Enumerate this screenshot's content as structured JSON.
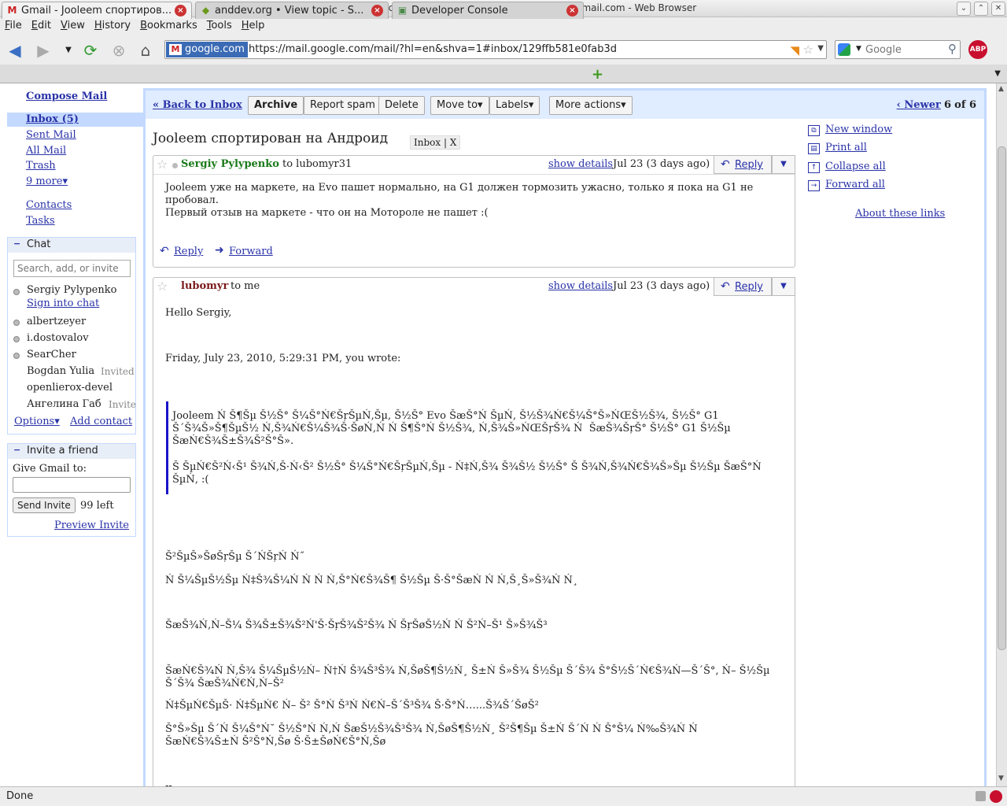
{
  "window": {
    "title": "Gmail - Jooleem спортирован на Андроид - x.pelya.x@gmail.com - Web Browser"
  },
  "menu": [
    "File",
    "Edit",
    "View",
    "History",
    "Bookmarks",
    "Tools",
    "Help"
  ],
  "address": {
    "site": "google.com",
    "url": "https://mail.google.com/mail/?hl=en&shva=1#inbox/129ffb581e0fab3d"
  },
  "search": {
    "placeholder": "Google"
  },
  "abp": "ABP",
  "tabs": [
    {
      "label": "Gmail - Jooleem спортиров..."
    },
    {
      "label": "anddev.org • View topic - S..."
    },
    {
      "label": "Developer Console"
    }
  ],
  "left": {
    "compose": "Compose Mail",
    "inbox": "Inbox (5)",
    "nav": [
      "Sent Mail",
      "All Mail",
      "Trash",
      "9 more▾"
    ],
    "contacts": "Contacts",
    "tasks": "Tasks"
  },
  "chat": {
    "title": "Chat",
    "search_placeholder": "Search, add, or invite",
    "me": "Sergiy Pylypenko",
    "sign_in": "Sign into chat",
    "contacts": [
      "albertzeyer",
      "i.dostovalov",
      "SearCher",
      "Bogdan Yulia",
      "openlierox-devel",
      "Ангелина Габ"
    ],
    "invited": "Invited",
    "invited2": "Invite",
    "options": "Options▾",
    "add_contact": "Add contact"
  },
  "invite": {
    "title": "Invite a friend",
    "give": "Give Gmail to:",
    "send": "Send Invite",
    "left": "99 left",
    "preview": "Preview Invite"
  },
  "toolbar": {
    "back": "« Back to Inbox",
    "archive": "Archive",
    "spam": "Report spam",
    "delete": "Delete",
    "move": "Move to▾",
    "labels": "Labels▾",
    "more": "More actions▾",
    "newer": "‹ Newer",
    "count": "6",
    "of": "of 6"
  },
  "subject": "Jooleem спортирован на Андроид",
  "label_chip": "Inbox",
  "label_x": "X",
  "messages": [
    {
      "from": "Sergiy Pylypenko",
      "to": "to lubomyr31",
      "show_details": "show details",
      "date": "Jul 23 (3 days ago)",
      "reply": "Reply",
      "body": "Jooleem уже на маркете, на Evo пашет нормально, на G1 должен тормозить ужасно, только я пока на G1 не\nпробовал.\nПервый отзыв на маркете - что он на Мотороле не пашет :(",
      "foot_reply": "Reply",
      "foot_forward": "Forward"
    },
    {
      "from": "lubomyr",
      "to": "to me",
      "show_details": "show details",
      "date": "Jul 23 (3 days ago)",
      "reply": "Reply",
      "greeting": "Hello Sergiy,",
      "wrote": "Friday, July 23, 2010, 5:29:31 PM, you wrote:",
      "quote1": "Jooleem Ń Š¶Šµ Š½Š° Š¼Š°Ń€ŠŗŠµŃ‚Šµ, Š½Š° Evo ŠæŠ°Ń ŠµŃ‚ Š½Š¾Ń€Š¼Š°Š»ŃŒŠ½Š¾, Š½Š° G1\nŠ´Š¾Š»Š¶ŠµŠ½ Ń‚Š¾Ń€Š¼Š¾Š·ŠøŃ‚Ń Ń Š¶Š°Ń Š½Š¾, Ń‚Š¾Š»ŃŒŠŗŠ¾ Ń  ŠæŠ¾ŠŗŠ° Š½Š° G1 Š½Šµ\nŠæŃ€Š¾Š±Š¾Š²Š°Š».",
      "quote2": "Š ŠµŃ€Š²Ń‹Š¹ Š¾Ń‚Š·Ń‹Š² Š½Š° Š¼Š°Ń€ŠŗŠµŃ‚Šµ - Ń‡Ń‚Š¾ Š¾Š½ Š½Š° Š Š¾Ń‚Š¾Ń€Š¾Š»Šµ Š½Šµ ŠæŠ°Ń\nŠµŃ‚ :(",
      "p1": "Š²ŠµŠ»ŠøŠŗŠµ Š´ŃŠŗŃ Ń˝",
      "p2": "Ń Š¼ŠµŠ½Šµ Ń‡Š¾Š¼Ń Ń Ń Ń‚Š°Ń€Š¾Š¶ Š½Šµ Š·Š°ŠæŃ Ń Ń‚Š¸Š»Š¾Ń Ń¸",
      "p3": "ŠæŠ¾Ń‚Ń–Š¼ Š¾Š±Š¾Š²Ń'Š·ŠŗŠ¾Š²Š¾ Ń ŠŗŠøŠ½Ń Ń Š²Ń–Š¹ Š»Š¾Š³",
      "p4": "ŠæŃ€Š¾Ń Ń‚Š¾ Š¼ŠµŠ½Ń– Ń†Ń Š¾Š³Š¾ Ń‚ŠøŠ¶Š½Ń¸ Š±Ń Š»Š¾ Š½Šµ Š´Š¾ Š°Š½Š´Ń€Š¾Ń—Š´Š°, Ń– Š½Šµ\nŠ´Š¾ ŠæŠ¾Ń€Ń‚Ń–Š²",
      "p5": "Ń‡ŠµŃ€ŠµŠ· Ń‡ŠµŃ€ Ń– Š² Š°Ń Š³Ń Ń€Ń–Š´Š³Š¾ Š·Š°Ń…...Š¾Š´ŠøŠ²",
      "p6": "Š°Š»Šµ Š´Ń Š¼Š°Ń˘ Š½Š°Ń Ń‚Ń ŠæŠ½Š¾Š³Š¾ Ń‚ŠøŠ¶Š½Ń¸ Š²Š¶Šµ Š±Ń Š´Ń Ń Š°Š¼ Ń‰Š¾Ń Ń\nŠæŃ€Š¾Š±Ń Š²Š°Ń‚Šø Š·Š±ŠøŃ€Š°Ń‚Šø",
      "sig": "--"
    }
  ],
  "right_links": [
    "New window",
    "Print all",
    "Collapse all",
    "Forward all"
  ],
  "about_links": "About these links",
  "status": "Done"
}
